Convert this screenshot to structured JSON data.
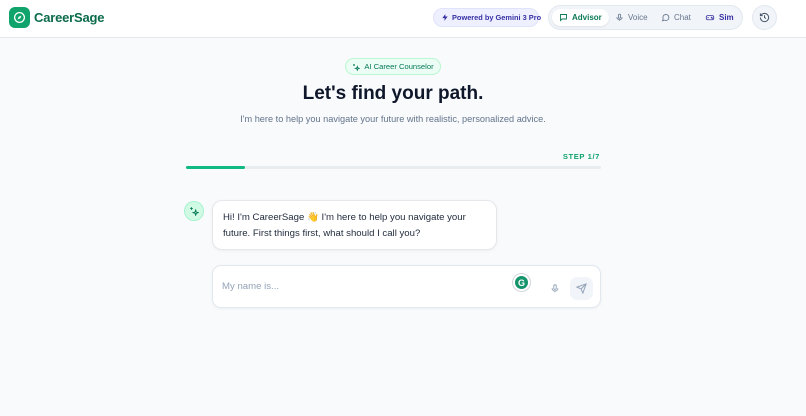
{
  "app": {
    "name": "CareerSage",
    "brand_color": "#10a36c",
    "icon": "compass-icon"
  },
  "header": {
    "powered_by": "Powered by Gemini 3 Pro",
    "modes": [
      {
        "label": "Advisor",
        "icon": "message-square-icon",
        "active": true
      },
      {
        "label": "Voice",
        "icon": "mic-icon",
        "active": false
      },
      {
        "label": "Chat",
        "icon": "message-circle-icon",
        "active": false
      },
      {
        "label": "Sim",
        "icon": "gamepad-icon",
        "active": false
      }
    ],
    "history_icon": "history-icon"
  },
  "hero": {
    "badge": "AI Career Counselor",
    "title": "Let's find your path.",
    "subtitle": "I'm here to help you navigate your future with realistic, personalized advice."
  },
  "progress": {
    "step_label": "STEP 1/7",
    "fraction": 0.143
  },
  "chat": {
    "bot_message": "Hi! I'm CareerSage 👋 I'm here to help you navigate your future. First things first, what should I call you?",
    "input_placeholder": "My name is...",
    "input_value": ""
  },
  "colors": {
    "accent": "#10b981",
    "indigo": "#3730a3",
    "background": "#f8fafc"
  }
}
